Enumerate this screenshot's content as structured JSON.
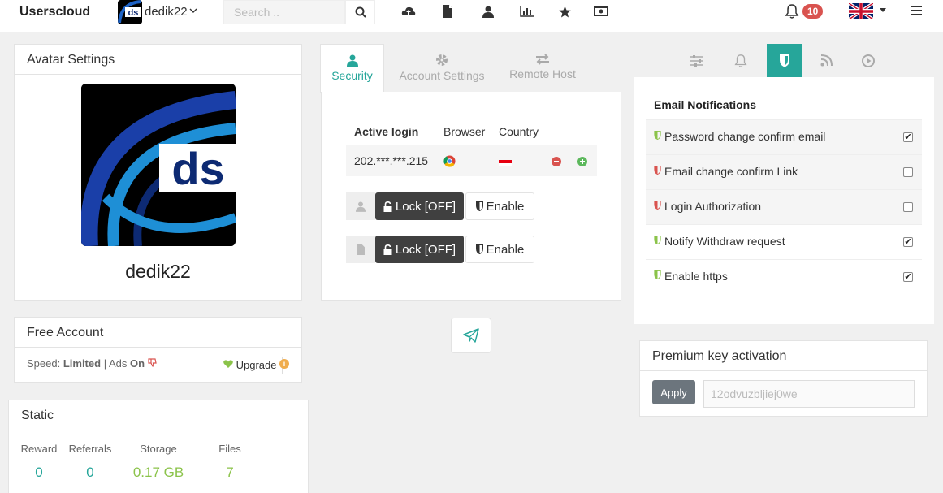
{
  "topbar": {
    "brand": "Userscloud",
    "username": "dedik22",
    "search_placeholder": "Search ..",
    "notification_count": "10"
  },
  "avatar_panel": {
    "title": "Avatar Settings",
    "avatar_text": "ds",
    "name": "dedik22"
  },
  "account_panel": {
    "title": "Free Account",
    "speed_label": "Speed:",
    "speed_value": "Limited",
    "separator": "|",
    "ads_label": "Ads",
    "ads_value": "On",
    "upgrade_label": "Upgrade"
  },
  "static_panel": {
    "title": "Static",
    "stats": [
      {
        "label": "Reward",
        "value": "0",
        "color": "#26a69a"
      },
      {
        "label": "Referrals",
        "value": "0",
        "color": "#26a69a"
      },
      {
        "label": "Storage",
        "value": "0.17 GB",
        "color": "#8bc34a"
      },
      {
        "label": "Files",
        "value": "7",
        "color": "#8bc34a"
      }
    ]
  },
  "center_tabs": [
    {
      "label": "Security",
      "icon": "user-icon",
      "active": true
    },
    {
      "label": "Account Settings",
      "icon": "gear-icon",
      "active": false
    },
    {
      "label": "Remote Host",
      "icon": "exchange-icon",
      "active": false
    }
  ],
  "login_table": {
    "headers": [
      "Active login",
      "Browser",
      "Country"
    ],
    "rows": [
      {
        "ip": "202.***.***.215",
        "browser_icon": "chrome-icon",
        "country_icon": "indonesia-flag-icon"
      }
    ]
  },
  "controls": [
    {
      "icon": "user-icon",
      "lock_label": "Lock [OFF]",
      "enable_label": "Enable"
    },
    {
      "icon": "file-icon",
      "lock_label": "Lock [OFF]",
      "enable_label": "Enable"
    }
  ],
  "email_panel": {
    "title": "Email Notifications",
    "items": [
      {
        "label": "Password change confirm email",
        "checked": true,
        "shield_color": "#8bc34a"
      },
      {
        "label": "Email change confirm Link",
        "checked": false,
        "shield_color": "#d9534f"
      },
      {
        "label": "Login Authorization",
        "checked": false,
        "shield_color": "#d9534f"
      },
      {
        "label": "Notify Withdraw request",
        "checked": true,
        "shield_color": "#8bc34a"
      },
      {
        "label": "Enable https",
        "checked": true,
        "shield_color": "#8bc34a"
      }
    ]
  },
  "premium_panel": {
    "title": "Premium key activation",
    "apply_label": "Apply",
    "key_placeholder": "12odvuzbljiej0we"
  },
  "colors": {
    "accent": "#26a69a",
    "dark_button": "#404040",
    "badge_red": "#d9534f",
    "green": "#8bc34a"
  }
}
